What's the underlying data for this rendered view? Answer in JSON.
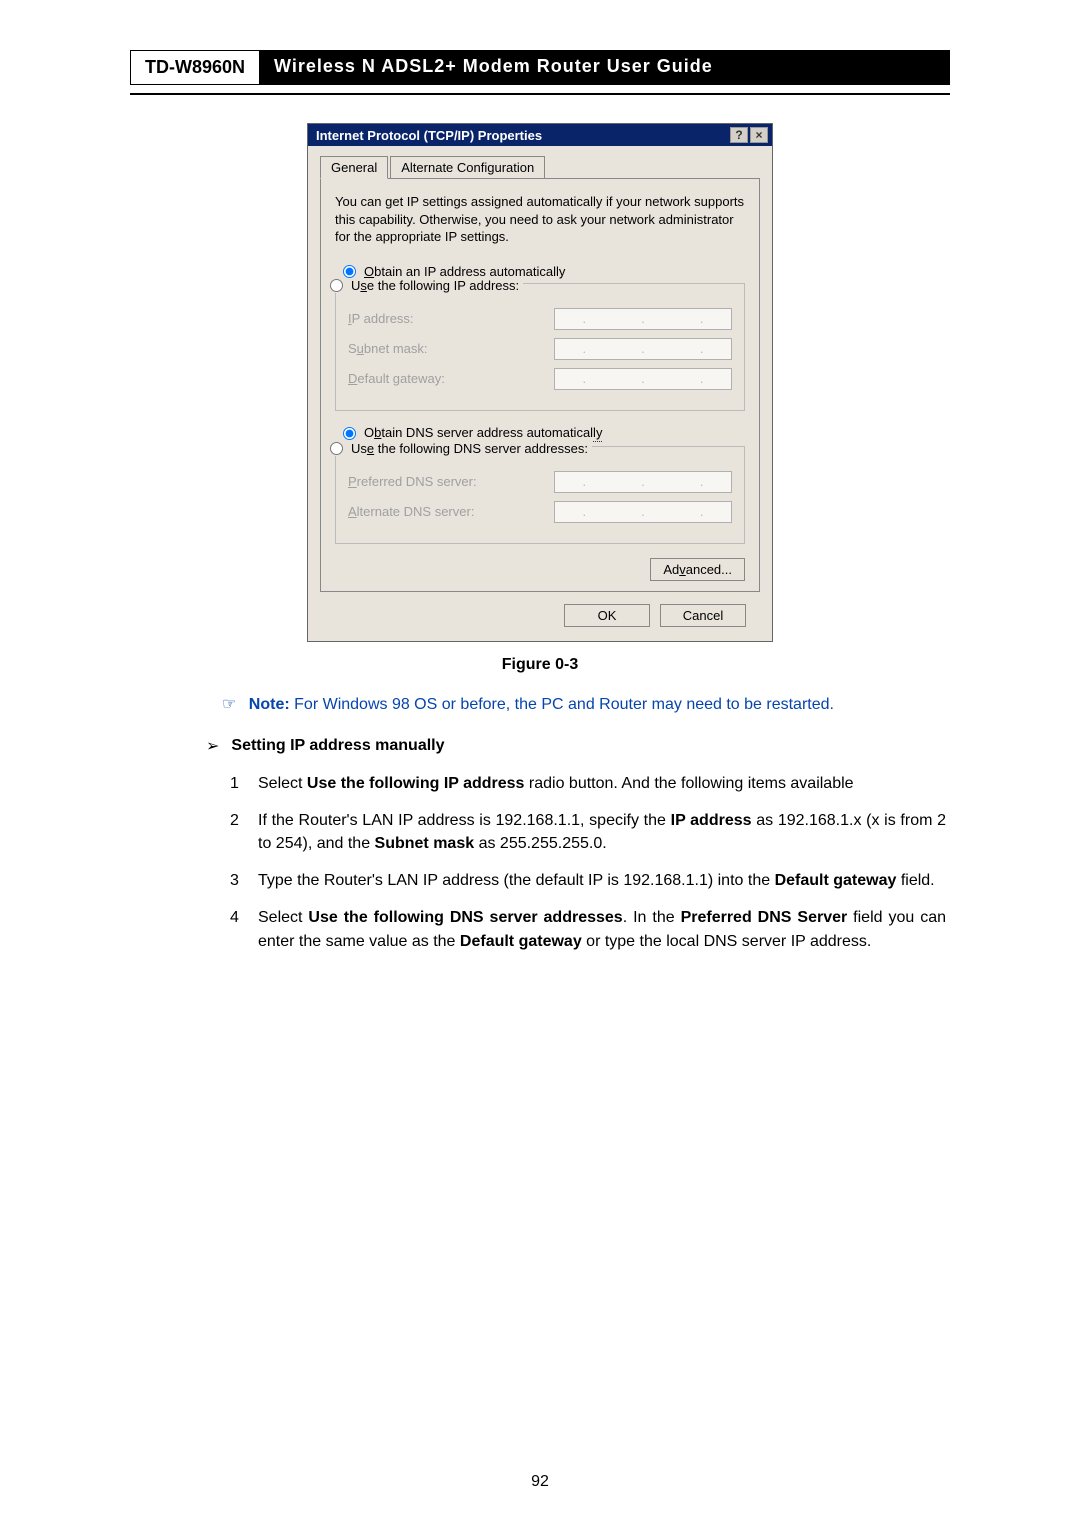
{
  "header": {
    "model": "TD-W8960N",
    "title": "Wireless  N  ADSL2+  Modem  Router  User  Guide"
  },
  "dialog": {
    "title": "Internet Protocol (TCP/IP) Properties",
    "help": "?",
    "close": "×",
    "tab_general": "General",
    "tab_alt": "Alternate Configuration",
    "intro": "You can get IP settings assigned automatically if your network supports this capability. Otherwise, you need to ask your network administrator for the appropriate IP settings.",
    "radio_auto_ip": "Obtain an IP address automatically",
    "radio_manual_ip": "Use the following IP address:",
    "label_ip": "IP address:",
    "label_subnet": "Subnet mask:",
    "label_gateway": "Default gateway:",
    "radio_auto_dns": "Obtain DNS server address automatically",
    "radio_manual_dns": "Use the following DNS server addresses:",
    "label_pref_dns": "Preferred DNS server:",
    "label_alt_dns": "Alternate DNS server:",
    "btn_advanced": "Advanced...",
    "btn_ok": "OK",
    "btn_cancel": "Cancel"
  },
  "caption": "Figure 0-3",
  "note": {
    "icon": "☞",
    "label": "Note:",
    "text": " For Windows 98 OS or before, the PC and Router may need to be restarted."
  },
  "section": {
    "chev": "➢",
    "title": "Setting IP address manually"
  },
  "steps": {
    "s1_num": "1",
    "s1_a": "Select ",
    "s1_b": "Use the following IP address",
    "s1_c": " radio button. And the following items available",
    "s2_num": "2",
    "s2_a": "If the Router's LAN IP address is 192.168.1.1, specify the ",
    "s2_b": "IP address",
    "s2_c": " as 192.168.1.x (x is from 2 to 254), and the ",
    "s2_d": "Subnet mask",
    "s2_e": " as 255.255.255.0.",
    "s3_num": "3",
    "s3_a": "Type the Router's LAN IP address (the default IP is 192.168.1.1) into the ",
    "s3_b": "Default gateway",
    "s3_c": " field.",
    "s4_num": "4",
    "s4_a": "Select ",
    "s4_b": "Use the following DNS server addresses",
    "s4_c": ".   In the ",
    "s4_d": "Preferred DNS Server",
    "s4_e": " field you can enter the same value as the ",
    "s4_f": "Default gateway",
    "s4_g": " or type the local DNS server IP address."
  },
  "page_number": "92"
}
